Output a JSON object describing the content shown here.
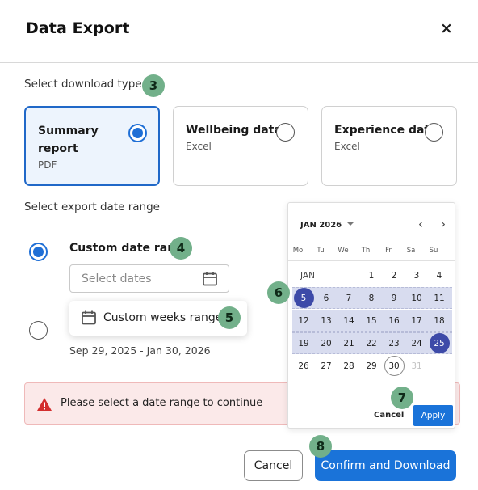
{
  "dialog": {
    "title": "Data Export",
    "close_label": "×"
  },
  "download_type": {
    "label": "Select download type",
    "badge": "3",
    "options": [
      {
        "title": "Summary report",
        "format": "PDF",
        "selected": true
      },
      {
        "title": "Wellbeing data",
        "format": "Excel",
        "selected": false
      },
      {
        "title": "Experience data",
        "format": "Excel",
        "selected": false
      }
    ]
  },
  "date_range": {
    "label": "Select export date range",
    "custom_label": "Custom date range",
    "custom_badge": "4",
    "input_placeholder": "Select dates",
    "weeks_label": "Custom weeks range",
    "weeks_badge": "5",
    "weeks_range_text": "Sep 29, 2025 - Jan 30, 2026"
  },
  "error": {
    "message": "Please select a date range to continue"
  },
  "calendar": {
    "month_label": "JAN 2026",
    "dropdown_icon": "caret-down-icon",
    "prev_icon": "chevron-left-icon",
    "next_icon": "chevron-right-icon",
    "weekdays": [
      "Mo",
      "Tu",
      "We",
      "Th",
      "Fr",
      "Sa",
      "Su"
    ],
    "month_short": "JAN",
    "weeks": [
      [
        "",
        "",
        "",
        "1",
        "2",
        "3",
        "4"
      ],
      [
        "5",
        "6",
        "7",
        "8",
        "9",
        "10",
        "11"
      ],
      [
        "12",
        "13",
        "14",
        "15",
        "16",
        "17",
        "18"
      ],
      [
        "19",
        "20",
        "21",
        "22",
        "23",
        "24",
        "25"
      ],
      [
        "26",
        "27",
        "28",
        "29",
        "30",
        "31",
        ""
      ]
    ],
    "range_start": "5",
    "range_end": "25",
    "today": "30",
    "disabled": [
      "31"
    ],
    "badge_range": "6",
    "badge_apply": "7",
    "cancel_label": "Cancel",
    "apply_label": "Apply",
    "accent_color": "#3d4aa8",
    "range_color": "#d8dcef"
  },
  "footer": {
    "cancel_label": "Cancel",
    "confirm_label": "Confirm and Download",
    "confirm_badge": "8"
  },
  "colors": {
    "primary": "#1a73d9",
    "badge": "#72b08a",
    "error_bg": "#fbe9e9",
    "error_icon": "#d32f2f"
  }
}
